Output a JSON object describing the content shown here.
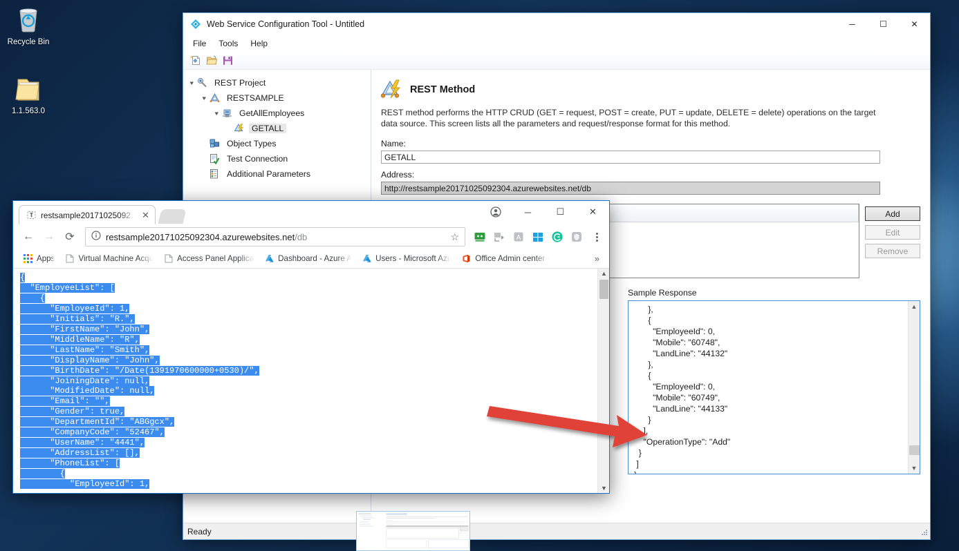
{
  "desktop": {
    "icons": [
      {
        "name": "Recycle Bin",
        "icon": "recycle-bin-icon"
      },
      {
        "name": "1.1.563.0",
        "icon": "folder-icon"
      }
    ]
  },
  "app_window": {
    "title": "Web Service Configuration Tool - Untitled",
    "icon": "app-diamond-icon",
    "window_controls": {
      "minimize": "─",
      "maximize": "☐",
      "close": "✕"
    },
    "menu": [
      "File",
      "Tools",
      "Help"
    ],
    "toolbar": [
      {
        "name": "new-project-button",
        "icon": "new-file-icon"
      },
      {
        "name": "open-project-button",
        "icon": "open-folder-icon"
      },
      {
        "name": "save-project-button",
        "icon": "floppy-save-icon"
      }
    ],
    "tree": [
      {
        "label": "REST Project",
        "indent": 0,
        "expander": "expanded",
        "icon": "rest-project-icon",
        "selected": false
      },
      {
        "label": "RESTSAMPLE",
        "indent": 1,
        "expander": "expanded",
        "icon": "service-icon",
        "selected": false
      },
      {
        "label": "GetAllEmployees",
        "indent": 2,
        "expander": "expanded",
        "icon": "resource-icon",
        "selected": false
      },
      {
        "label": "GETALL",
        "indent": 3,
        "expander": "none",
        "icon": "method-icon",
        "selected": true
      },
      {
        "label": "Object Types",
        "indent": 1,
        "expander": "none",
        "icon": "object-types-icon",
        "selected": false
      },
      {
        "label": "Test Connection",
        "indent": 1,
        "expander": "none",
        "icon": "test-connection-icon",
        "selected": false
      },
      {
        "label": "Additional Parameters",
        "indent": 1,
        "expander": "none",
        "icon": "parameters-icon",
        "selected": false
      }
    ],
    "detail": {
      "heading": "REST Method",
      "heading_icon": "rest-method-icon",
      "description": "REST method performs the HTTP CRUD (GET = request, POST = create, PUT = update, DELETE = delete) operations on the target data source. This screen lists all the parameters and request/response format for this method.",
      "name_label": "Name:",
      "name_value": "GETALL",
      "address_label": "Address:",
      "address_value": "http://restsample20171025092304.azurewebsites.net/db",
      "buttons": [
        {
          "label": "Add",
          "state": "enabled"
        },
        {
          "label": "Edit",
          "state": "disabled"
        },
        {
          "label": "Remove",
          "state": "disabled"
        }
      ],
      "sample_response_label": "Sample Response",
      "sample_response_text": "      },\n      {\n        \"EmployeeId\": 0,\n        \"Mobile\": \"60748\",\n        \"LandLine\": \"44132\"\n      },\n      {\n        \"EmployeeId\": 0,\n        \"Mobile\": \"60749\",\n        \"LandLine\": \"44133\"\n      }\n    ],\n    \"OperationType\": \"Add\"\n  }\n ]\n}"
    },
    "status_bar": {
      "text": "Ready"
    }
  },
  "browser": {
    "tab": {
      "title": "restsample20171025092…",
      "favicon": "page-favicon",
      "close_label": "✕"
    },
    "new_tab_label": "+",
    "window_controls": {
      "profile": "●",
      "minimize": "─",
      "maximize": "☐",
      "close": "✕"
    },
    "nav": {
      "back": "←",
      "forward": "→",
      "reload": "⟳"
    },
    "omnibox": {
      "security_icon": "info-circle-icon",
      "url_host": "restsample20171025092304.azurewebsites.net",
      "url_path": "/db",
      "bookmark_icon": "star-icon"
    },
    "extensions": [
      {
        "name": "green-screen-extension-icon",
        "color": "#2e9e3e",
        "glyph": "••"
      },
      {
        "name": "video-download-extension-icon",
        "color": "#9aa0a6",
        "glyph": "▶"
      },
      {
        "name": "text-tool-extension-icon",
        "color": "#9aa0a6",
        "glyph": "A"
      },
      {
        "name": "windows-extension-icon",
        "color": "#1ba1e2",
        "glyph": "⊞"
      },
      {
        "name": "grammarly-extension-icon",
        "color": "#15c39a",
        "glyph": "G"
      },
      {
        "name": "shield-extension-icon",
        "color": "#9aa0a6",
        "glyph": "●"
      }
    ],
    "menu_icon": "chrome-menu-icon",
    "bookmarks": [
      {
        "label": "Apps",
        "icon": "apps-grid-icon"
      },
      {
        "label": "Virtual Machine Acqu",
        "icon": "page-icon"
      },
      {
        "label": "Access Panel Applicat",
        "icon": "page-icon"
      },
      {
        "label": "Dashboard - Azure A",
        "icon": "azure-icon"
      },
      {
        "label": "Users - Microsoft Azu",
        "icon": "azure-icon"
      },
      {
        "label": "Office Admin center -",
        "icon": "office-icon"
      }
    ],
    "bookmarks_overflow": "»",
    "page_json_lines": [
      {
        "text": "{",
        "selected": true
      },
      {
        "text": "  \"EmployeeList\": [",
        "selected": true
      },
      {
        "text": "    {",
        "selected": true
      },
      {
        "text": "      \"EmployeeId\": 1,",
        "selected": true
      },
      {
        "text": "      \"Initials\": \"R.\",",
        "selected": true
      },
      {
        "text": "      \"FirstName\": \"John\",",
        "selected": true
      },
      {
        "text": "      \"MiddleName\": \"R\",",
        "selected": true
      },
      {
        "text": "      \"LastName\": \"Smith\",",
        "selected": true
      },
      {
        "text": "      \"DisplayName\": \"John\",",
        "selected": true
      },
      {
        "text": "      \"BirthDate\": \"/Date(1391970600000+0530)/\",",
        "selected": true
      },
      {
        "text": "      \"JoiningDate\": null,",
        "selected": true
      },
      {
        "text": "      \"ModifiedDate\": null,",
        "selected": true
      },
      {
        "text": "      \"Email\": \"\",",
        "selected": true
      },
      {
        "text": "      \"Gender\": true,",
        "selected": true
      },
      {
        "text": "      \"DepartmentId\": \"ABGgcx\",",
        "selected": true
      },
      {
        "text": "      \"CompanyCode\": \"52467\",",
        "selected": true
      },
      {
        "text": "      \"UserName\": \"4441\",",
        "selected": true
      },
      {
        "text": "      \"AddressList\": [],",
        "selected": true
      },
      {
        "text": "      \"PhoneList\": [",
        "selected": true
      },
      {
        "text": "        {",
        "selected": true
      },
      {
        "text": "          \"EmployeeId\": 1,",
        "selected": true
      }
    ]
  },
  "annotation": {
    "arrow_color": "#e04338",
    "name": "red-pointer-arrow"
  },
  "colors": {
    "accent_blue": "#1a73c8",
    "selection_blue": "#3c8cf0",
    "desktop_dark": "#0c2340"
  }
}
